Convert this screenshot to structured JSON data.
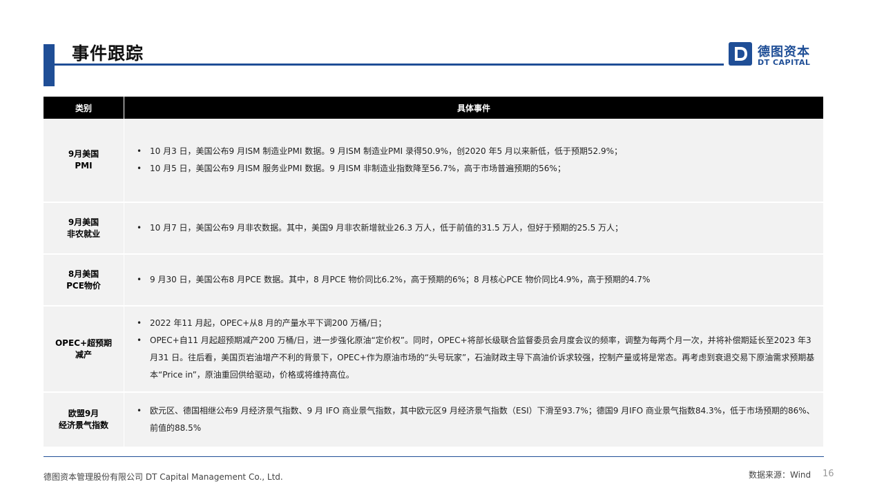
{
  "header": {
    "title": "事件跟踪"
  },
  "logo": {
    "cn": "德图资本",
    "en": "DT CAPITAL",
    "mark": "D"
  },
  "table": {
    "col_category": "类别",
    "col_events": "具体事件",
    "rows": [
      {
        "category": "9月美国\nPMI",
        "events": [
          "10 月3 日，美国公布9 月ISM 制造业PMI 数据。9 月ISM 制造业PMI 录得50.9%，创2020 年5 月以来新低，低于预期52.9%；",
          "10 月5 日，美国公布9 月ISM 服务业PMI 数据。9 月ISM 非制造业指数降至56.7%，高于市场普遍预期的56%；"
        ]
      },
      {
        "category": "9月美国\n非农就业",
        "events": [
          "10 月7 日，美国公布9 月非农数据。其中，美国9 月非农新增就业26.3 万人，低于前值的31.5 万人，但好于预期的25.5 万人；"
        ]
      },
      {
        "category": "8月美国\nPCE物价",
        "events": [
          "9 月30 日，美国公布8 月PCE 数据。其中，8 月PCE 物价同比6.2%，高于预期的6%；8 月核心PCE 物价同比4.9%，高于预期的4.7%"
        ]
      },
      {
        "category": "OPEC+超预期\n减产",
        "events": [
          "2022 年11 月起，OPEC+从8 月的产量水平下调200 万桶/日；",
          "OPEC+自11 月起超预期减产200 万桶/日，进一步强化原油“定价权”。同时，OPEC+将部长级联合监督委员会月度会议的频率，调整为每两个月一次，并将补偿期延长至2023 年3 月31 日。往后看，美国页岩油增产不利的背景下，OPEC+作为原油市场的“头号玩家”，石油财政主导下高油价诉求较强，控制产量或将是常态。再考虑到衰退交易下原油需求预期基本“Price in”，原油重回供给驱动，价格或将维持高位。"
        ]
      },
      {
        "category": "欧盟9月\n经济景气指数",
        "events": [
          "欧元区、德国相继公布9 月经济景气指数、9 月 IFO 商业景气指数，其中欧元区9 月经济景气指数（ESI）下滑至93.7%；德国9 月IFO 商业景气指数84.3%，低于市场预期的86%、前值的88.5%"
        ]
      }
    ]
  },
  "footer": {
    "company": "德图资本管理股份有限公司  DT Capital  Management  Co., Ltd.",
    "source": "数据来源：Wind",
    "page": "16"
  },
  "colors": {
    "brand_blue": "#1f4e96",
    "header_bg": "#000000",
    "row_bg": "#f2f2f2"
  }
}
